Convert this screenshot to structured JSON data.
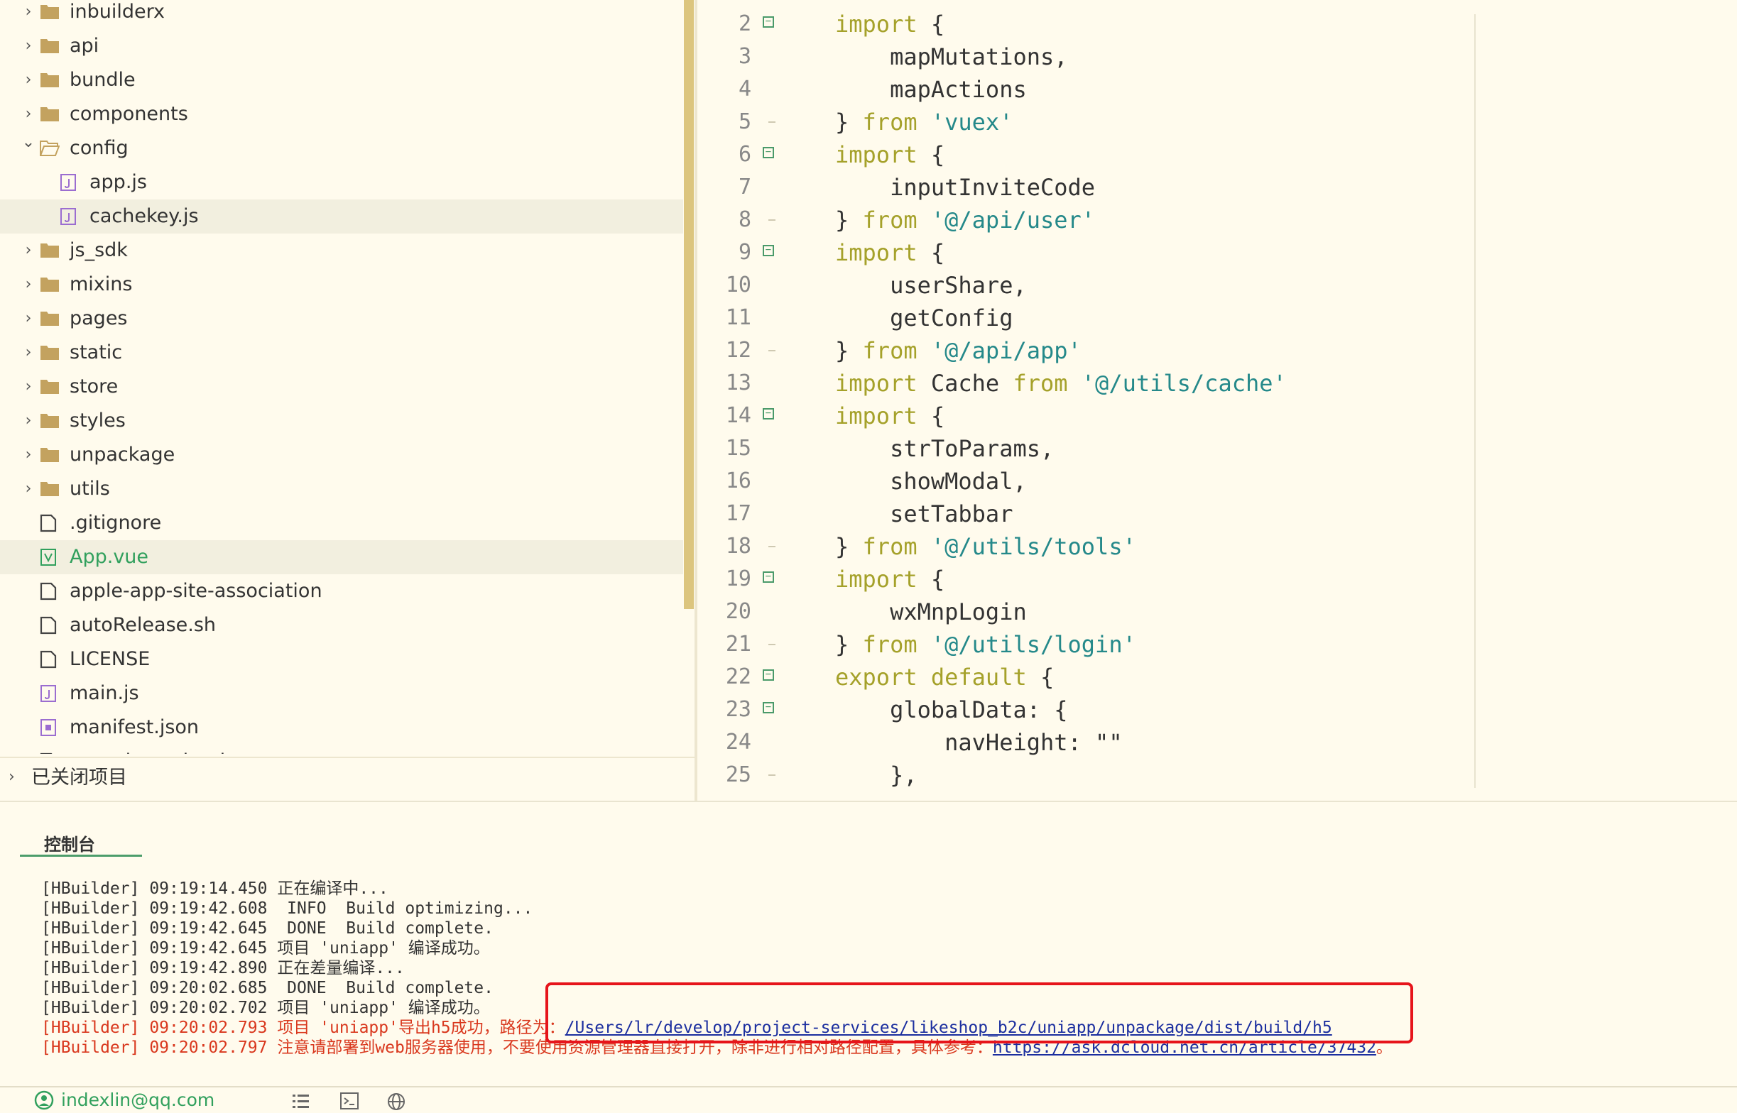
{
  "explorer": {
    "items": [
      {
        "label": "inbuilderx",
        "type": "folder",
        "expanded": false,
        "depth": 0
      },
      {
        "label": "api",
        "type": "folder",
        "expanded": false,
        "depth": 0
      },
      {
        "label": "bundle",
        "type": "folder",
        "expanded": false,
        "depth": 0
      },
      {
        "label": "components",
        "type": "folder",
        "expanded": false,
        "depth": 0
      },
      {
        "label": "config",
        "type": "folder",
        "expanded": true,
        "depth": 0
      },
      {
        "label": "app.js",
        "type": "js",
        "depth": 1
      },
      {
        "label": "cachekey.js",
        "type": "js",
        "depth": 1,
        "selected": true
      },
      {
        "label": "js_sdk",
        "type": "folder",
        "expanded": false,
        "depth": 0
      },
      {
        "label": "mixins",
        "type": "folder",
        "expanded": false,
        "depth": 0
      },
      {
        "label": "pages",
        "type": "folder",
        "expanded": false,
        "depth": 0
      },
      {
        "label": "static",
        "type": "folder",
        "expanded": false,
        "depth": 0
      },
      {
        "label": "store",
        "type": "folder",
        "expanded": false,
        "depth": 0
      },
      {
        "label": "styles",
        "type": "folder",
        "expanded": false,
        "depth": 0
      },
      {
        "label": "unpackage",
        "type": "folder",
        "expanded": false,
        "depth": 0
      },
      {
        "label": "utils",
        "type": "folder",
        "expanded": false,
        "depth": 0
      },
      {
        "label": ".gitignore",
        "type": "file",
        "depth": 0
      },
      {
        "label": "App.vue",
        "type": "vue",
        "depth": 0,
        "selected": true
      },
      {
        "label": "apple-app-site-association",
        "type": "file",
        "depth": 0
      },
      {
        "label": "autoRelease.sh",
        "type": "file",
        "depth": 0
      },
      {
        "label": "LICENSE",
        "type": "file",
        "depth": 0
      },
      {
        "label": "main.js",
        "type": "js",
        "depth": 0
      },
      {
        "label": "manifest.json",
        "type": "json",
        "depth": 0
      },
      {
        "label": "my-release-key.keystore",
        "type": "file",
        "depth": 0
      }
    ],
    "closed_projects_label": "已关闭项目"
  },
  "editor": {
    "lines": [
      {
        "n": "2",
        "fold": "open",
        "tokens": [
          {
            "t": "import",
            "c": "kw"
          },
          {
            "t": " {",
            "c": "plain"
          }
        ]
      },
      {
        "n": "3",
        "tokens": [
          {
            "t": "    mapMutations,",
            "c": "plain"
          }
        ]
      },
      {
        "n": "4",
        "tokens": [
          {
            "t": "    mapActions",
            "c": "plain"
          }
        ]
      },
      {
        "n": "5",
        "fold": "end",
        "tokens": [
          {
            "t": "} ",
            "c": "plain"
          },
          {
            "t": "from",
            "c": "kw"
          },
          {
            "t": " ",
            "c": "plain"
          },
          {
            "t": "'vuex'",
            "c": "str"
          }
        ]
      },
      {
        "n": "6",
        "fold": "open",
        "tokens": [
          {
            "t": "import",
            "c": "kw"
          },
          {
            "t": " {",
            "c": "plain"
          }
        ]
      },
      {
        "n": "7",
        "tokens": [
          {
            "t": "    inputInviteCode",
            "c": "plain"
          }
        ]
      },
      {
        "n": "8",
        "fold": "end",
        "tokens": [
          {
            "t": "} ",
            "c": "plain"
          },
          {
            "t": "from",
            "c": "kw"
          },
          {
            "t": " ",
            "c": "plain"
          },
          {
            "t": "'@/api/user'",
            "c": "str"
          }
        ]
      },
      {
        "n": "9",
        "fold": "open",
        "tokens": [
          {
            "t": "import",
            "c": "kw"
          },
          {
            "t": " {",
            "c": "plain"
          }
        ]
      },
      {
        "n": "10",
        "tokens": [
          {
            "t": "    userShare,",
            "c": "plain"
          }
        ]
      },
      {
        "n": "11",
        "tokens": [
          {
            "t": "    getConfig",
            "c": "plain"
          }
        ]
      },
      {
        "n": "12",
        "fold": "end",
        "tokens": [
          {
            "t": "} ",
            "c": "plain"
          },
          {
            "t": "from",
            "c": "kw"
          },
          {
            "t": " ",
            "c": "plain"
          },
          {
            "t": "'@/api/app'",
            "c": "str"
          }
        ]
      },
      {
        "n": "13",
        "tokens": [
          {
            "t": "import",
            "c": "kw"
          },
          {
            "t": " Cache ",
            "c": "plain"
          },
          {
            "t": "from",
            "c": "kw"
          },
          {
            "t": " ",
            "c": "plain"
          },
          {
            "t": "'@/utils/cache'",
            "c": "str"
          }
        ]
      },
      {
        "n": "14",
        "fold": "open",
        "tokens": [
          {
            "t": "import",
            "c": "kw"
          },
          {
            "t": " {",
            "c": "plain"
          }
        ]
      },
      {
        "n": "15",
        "tokens": [
          {
            "t": "    strToParams,",
            "c": "plain"
          }
        ]
      },
      {
        "n": "16",
        "tokens": [
          {
            "t": "    showModal,",
            "c": "plain"
          }
        ]
      },
      {
        "n": "17",
        "tokens": [
          {
            "t": "    setTabbar",
            "c": "plain"
          }
        ]
      },
      {
        "n": "18",
        "fold": "end",
        "tokens": [
          {
            "t": "} ",
            "c": "plain"
          },
          {
            "t": "from",
            "c": "kw"
          },
          {
            "t": " ",
            "c": "plain"
          },
          {
            "t": "'@/utils/tools'",
            "c": "str"
          }
        ]
      },
      {
        "n": "19",
        "fold": "open",
        "tokens": [
          {
            "t": "import",
            "c": "kw"
          },
          {
            "t": " {",
            "c": "plain"
          }
        ]
      },
      {
        "n": "20",
        "tokens": [
          {
            "t": "    wxMnpLogin",
            "c": "plain"
          }
        ]
      },
      {
        "n": "21",
        "fold": "end",
        "tokens": [
          {
            "t": "} ",
            "c": "plain"
          },
          {
            "t": "from",
            "c": "kw"
          },
          {
            "t": " ",
            "c": "plain"
          },
          {
            "t": "'@/utils/login'",
            "c": "str"
          }
        ]
      },
      {
        "n": "22",
        "fold": "open",
        "tokens": [
          {
            "t": "export default",
            "c": "kw"
          },
          {
            "t": " {",
            "c": "plain"
          }
        ]
      },
      {
        "n": "23",
        "fold": "open",
        "tokens": [
          {
            "t": "    globalData: {",
            "c": "plain"
          }
        ]
      },
      {
        "n": "24",
        "tokens": [
          {
            "t": "        navHeight: \"\"",
            "c": "plain"
          }
        ]
      },
      {
        "n": "25",
        "fold": "end",
        "tokens": [
          {
            "t": "    },",
            "c": "plain"
          }
        ]
      }
    ]
  },
  "console": {
    "tab_label": "控制台",
    "lines": [
      {
        "text": "[HBuilder] 09:19:14.450 正在编译中...",
        "error": false
      },
      {
        "text": "[HBuilder] 09:19:42.608  INFO  Build optimizing...",
        "error": false
      },
      {
        "text": "[HBuilder] 09:19:42.645  DONE  Build complete.",
        "error": false
      },
      {
        "text": "[HBuilder] 09:19:42.645 项目 'uniapp' 编译成功。",
        "error": false
      },
      {
        "text": "[HBuilder] 09:19:42.890 正在差量编译...",
        "error": false
      },
      {
        "text": "[HBuilder] 09:20:02.685  DONE  Build complete.",
        "error": false
      },
      {
        "text": "[HBuilder] 09:20:02.702 项目 'uniapp' 编译成功。",
        "error": false
      },
      {
        "text": "[HBuilder] 09:20:02.793 项目 'uniapp'导出h5成功，路径为：",
        "error": true,
        "link": "/Users/lr/develop/project-services/likeshop_b2c/uniapp/unpackage/dist/build/h5",
        "suffix": ""
      },
      {
        "text": "[HBuilder] 09:20:02.797 注意请部署到web服务器使用，不要使用资源管理器直接打开，除非进行相对路径配置，具体参考：",
        "error": true,
        "link": "https://ask.dcloud.net.cn/article/37432",
        "suffix": "。"
      }
    ]
  },
  "status_bar": {
    "user_email": "indexlin@qq.com"
  },
  "colors": {
    "background": "#fffbed",
    "keyword": "#a5a12a",
    "string": "#25898a",
    "error": "#d9381e",
    "accent_green": "#31a05d",
    "highlight_box": "#e6141b"
  }
}
